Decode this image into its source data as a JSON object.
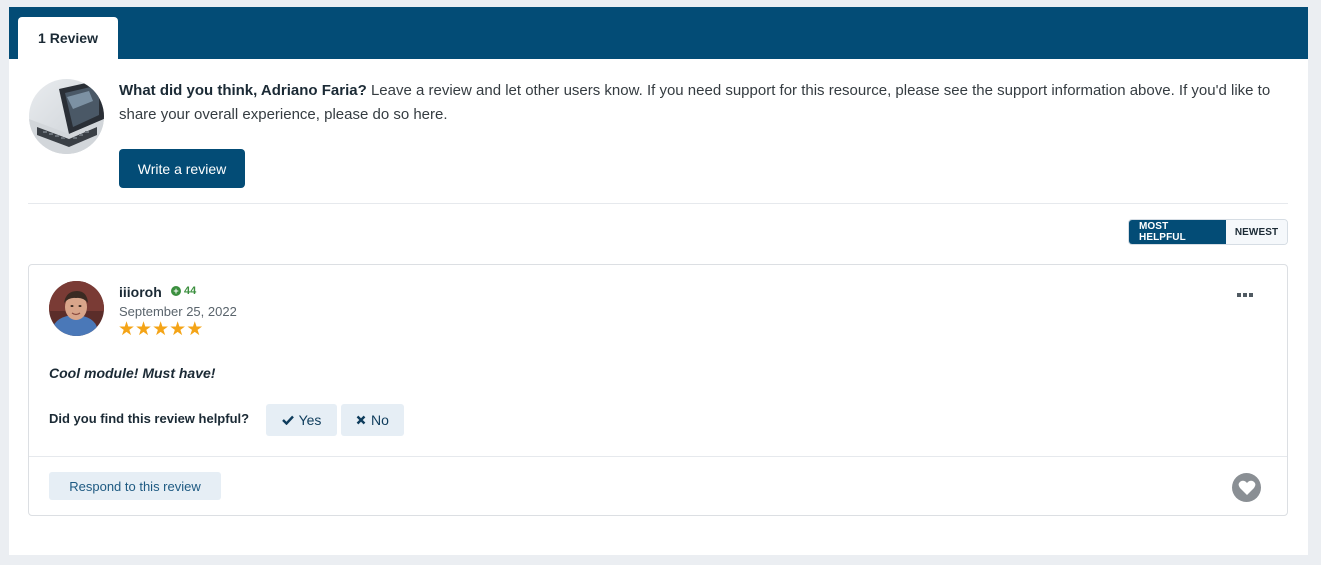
{
  "tabs": [
    {
      "label": "1 Review",
      "active": true
    }
  ],
  "prompt": {
    "question": "What did you think, Adriano Faria?",
    "text": " Leave a review and let other users know. If you need support for this resource, please see the support information above. If you'd like to share your overall experience, please do so here.",
    "write_button": "Write a review"
  },
  "sort": {
    "options": [
      "MOST HELPFUL",
      "NEWEST"
    ],
    "selected": "MOST HELPFUL"
  },
  "review": {
    "author": "iiioroh",
    "reputation": "44",
    "date": "September 25, 2022",
    "rating": 5,
    "rating_max": 5,
    "body": "Cool module! Must have!",
    "helpful_question": "Did you find this review helpful?",
    "yes_label": "Yes",
    "no_label": "No",
    "respond_label": "Respond to this review"
  },
  "colors": {
    "brand": "#034c76",
    "star": "#f4a417",
    "reputation": "#3b8f3e",
    "light_button": "#e6eef5"
  },
  "icons": [
    "plus-circle-icon",
    "star-icon",
    "ellipsis-icon",
    "check-icon",
    "x-icon",
    "heart-icon"
  ]
}
